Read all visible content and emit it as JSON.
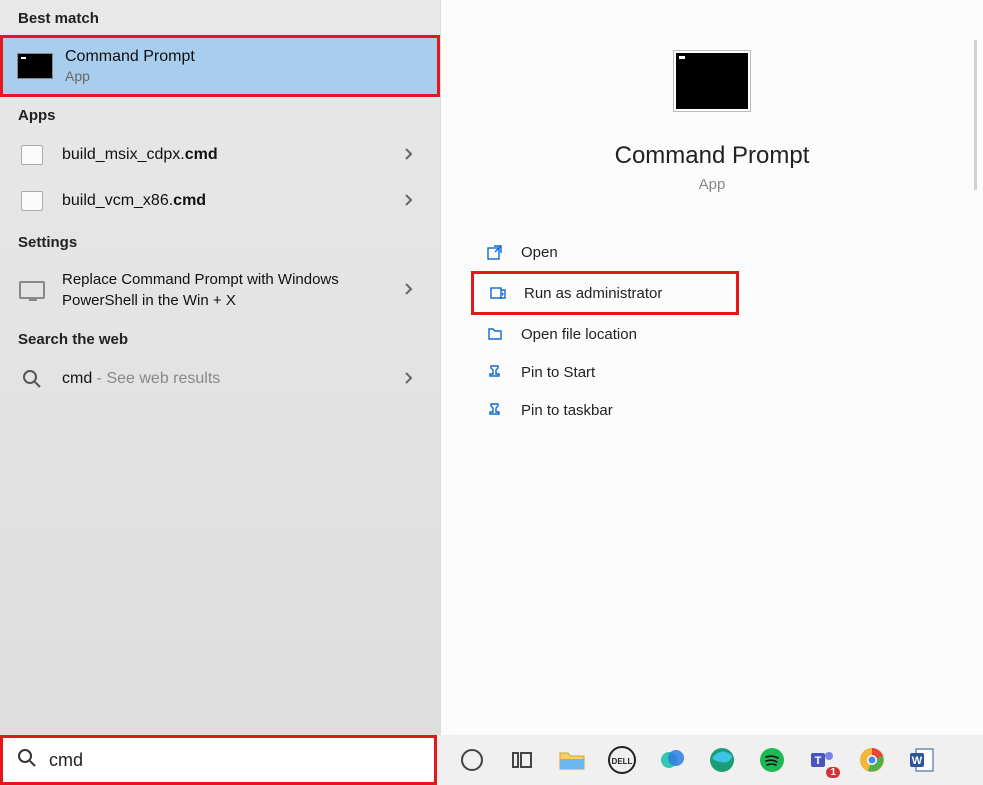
{
  "left": {
    "bestMatchHeader": "Best match",
    "bestMatch": {
      "title": "Command Prompt",
      "sub": "App"
    },
    "appsHeader": "Apps",
    "apps": [
      {
        "prefix": "build_msix_cdpx.",
        "bold": "cmd"
      },
      {
        "prefix": "build_vcm_x86.",
        "bold": "cmd"
      }
    ],
    "settingsHeader": "Settings",
    "settingsItem": "Replace Command Prompt with Windows PowerShell in the Win + X",
    "webHeader": "Search the web",
    "webItem": {
      "term": "cmd",
      "suffix": " - See web results"
    }
  },
  "right": {
    "title": "Command Prompt",
    "sub": "App",
    "actions": [
      {
        "label": "Open",
        "icon": "open-icon"
      },
      {
        "label": "Run as administrator",
        "icon": "admin-icon"
      },
      {
        "label": "Open file location",
        "icon": "folder-icon"
      },
      {
        "label": "Pin to Start",
        "icon": "pin-icon"
      },
      {
        "label": "Pin to taskbar",
        "icon": "pin-icon"
      }
    ]
  },
  "search": {
    "value": "cmd"
  }
}
